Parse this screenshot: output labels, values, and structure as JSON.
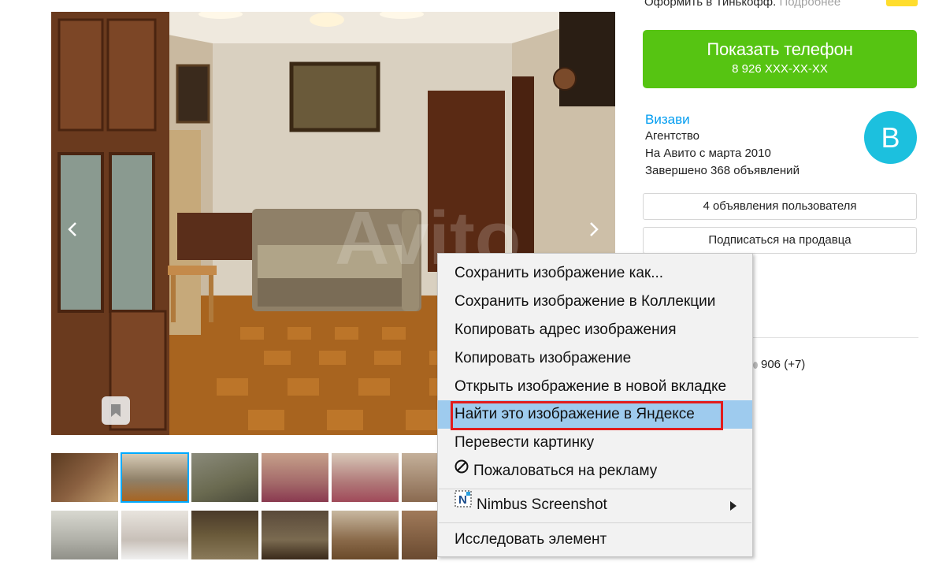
{
  "top_strip": {
    "text": "Оформить в Тинькофф.",
    "more": "Подробнее"
  },
  "colors": {
    "accent_green": "#56c412",
    "link_blue": "#009cf0",
    "avatar_bg": "#1cc0de",
    "highlight": "#9ecbee",
    "annotation_red": "#e21c1c"
  },
  "photo": {
    "watermark": "Avito",
    "prev_icon": "chevron-left-icon",
    "next_icon": "chevron-right-icon",
    "bookmark_icon": "bookmark-icon"
  },
  "thumbnails": {
    "row1_count": 8,
    "row2_count": 8,
    "active_index": 1
  },
  "phone": {
    "title": "Показать телефон",
    "number": "8 926 XXX-XX-XX"
  },
  "seller": {
    "name": "Визави",
    "type": "Агентство",
    "since": "На Авито с марта 2010",
    "completed": "Завершено 368 объявлений",
    "avatar_letter": "В"
  },
  "buttons": {
    "user_ads": "4 объявления пользователя",
    "subscribe": "Подписаться на продавца"
  },
  "views": "906 (+7)",
  "context_menu": {
    "items": [
      "Сохранить изображение как...",
      "Сохранить изображение в Коллекции",
      "Копировать адрес изображения",
      "Копировать изображение",
      "Открыть изображение в новой вкладке",
      "Найти это изображение в Яндексе",
      "Перевести картинку",
      "Пожаловаться на рекламу",
      "Nimbus Screenshot",
      "Исследовать элемент"
    ],
    "highlighted_index": 5
  }
}
